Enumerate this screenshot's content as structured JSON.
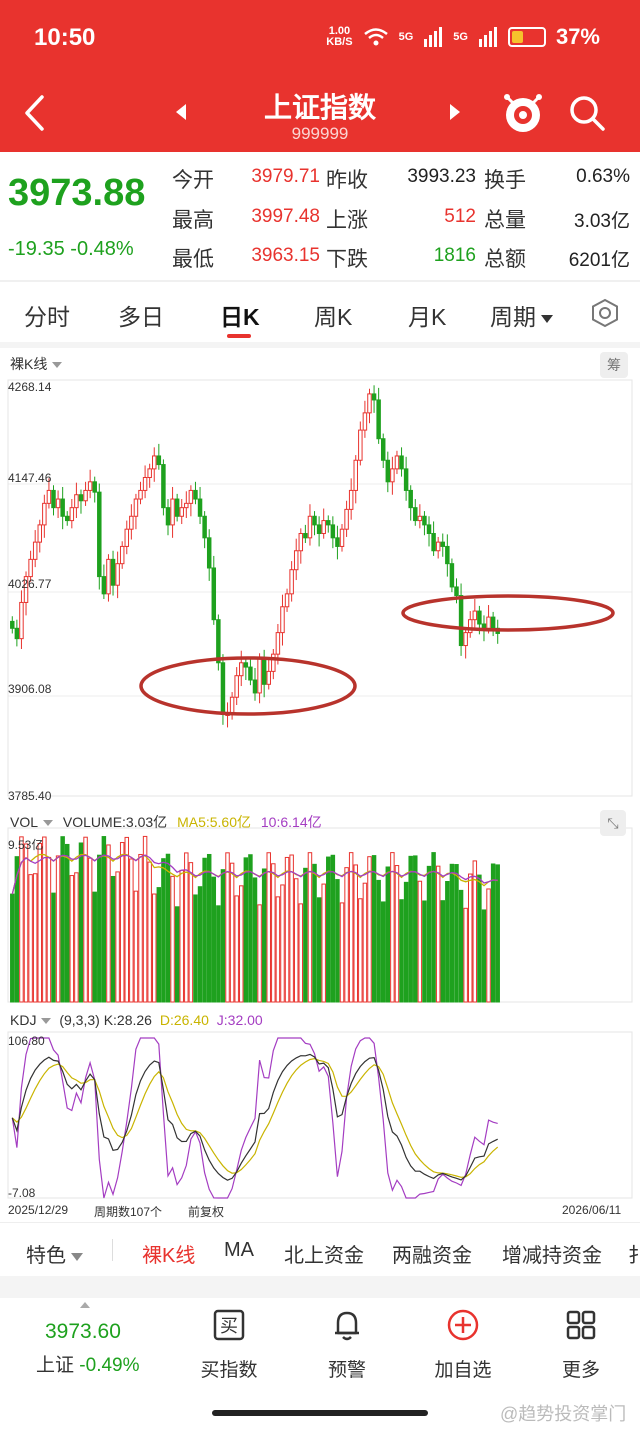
{
  "status_bar": {
    "time": "10:50",
    "speed": "1.00",
    "speed_unit": "KB/S",
    "net1": "5G",
    "net2": "5G",
    "battery": "37%",
    "battery_level": 0.37
  },
  "header": {
    "title": "上证指数",
    "code": "999999"
  },
  "quote": {
    "price": "3973.88",
    "change": "-19.35",
    "change_pct": "-0.48%",
    "open_label": "今开",
    "open": "3979.71",
    "high_label": "最高",
    "high": "3997.48",
    "low_label": "最低",
    "low": "3963.15",
    "prev_close_label": "昨收",
    "prev_close": "3993.23",
    "up_label": "上涨",
    "up": "512",
    "down_label": "下跌",
    "down": "1816",
    "turnover_label": "换手",
    "turnover": "0.63%",
    "volume_label": "总量",
    "volume": "3.03亿",
    "amount_label": "总额",
    "amount": "6201亿"
  },
  "tabs": [
    "分时",
    "多日",
    "日K",
    "周K",
    "月K",
    "周期"
  ],
  "tabs_active": "日K",
  "chart": {
    "kline_label": "裸K线",
    "chip_label": "筹",
    "y_ticks": [
      "4268.14",
      "4147.46",
      "4026.77",
      "3906.08",
      "3785.40"
    ],
    "vol_label": "VOL",
    "vol_value": "VOLUME:3.03亿",
    "vol_ma5": "MA5:5.60亿",
    "vol_ma10": "10:6.14亿",
    "vol_max": "9.53亿",
    "kdj_label": "KDJ",
    "kdj_params": "(9,3,3)",
    "kdj_k": "K:28.26",
    "kdj_d": "D:26.40",
    "kdj_j": "J:32.00",
    "kdj_max": "106.80",
    "kdj_min": "-7.08",
    "start_date": "2025/12/29",
    "period_count": "周期数107个",
    "adjust": "前复权",
    "end_date": "2026/06/11"
  },
  "chart_data": {
    "type": "candlestick",
    "ylim": [
      3785.4,
      4268.14
    ],
    "closes": [
      3980,
      3968,
      4010,
      4040,
      4060,
      4080,
      4100,
      4125,
      4140,
      4120,
      4130,
      4110,
      4105,
      4120,
      4135,
      4128,
      4140,
      4150,
      4138,
      4040,
      4020,
      4060,
      4030,
      4055,
      4075,
      4095,
      4110,
      4130,
      4140,
      4155,
      4165,
      4180,
      4170,
      4120,
      4100,
      4130,
      4110,
      4120,
      4125,
      4140,
      4130,
      4110,
      4085,
      4050,
      3990,
      3940,
      3880,
      3880,
      3900,
      3925,
      3940,
      3935,
      3920,
      3905,
      3945,
      3915,
      3930,
      3950,
      3975,
      4005,
      4020,
      4048,
      4070,
      4090,
      4085,
      4110,
      4100,
      4090,
      4105,
      4100,
      4085,
      4075,
      4095,
      4118,
      4140,
      4175,
      4210,
      4230,
      4252,
      4245,
      4200,
      4175,
      4150,
      4165,
      4180,
      4165,
      4140,
      4120,
      4105,
      4110,
      4100,
      4090,
      4070,
      4080,
      4075,
      4055,
      4028,
      4018,
      3960,
      3975,
      3990,
      4000,
      3985,
      3980,
      3993,
      3980,
      3974
    ],
    "volume_ma5": "5.60亿",
    "volume_ma10": "6.14亿",
    "volume_latest": "3.03亿",
    "kdj": {
      "K": 28.26,
      "D": 26.4,
      "J": 32.0,
      "range": [
        -7.08,
        106.8
      ]
    }
  },
  "indicators": [
    "特色",
    "裸K线",
    "MA",
    "北上资金",
    "两融资金",
    "增减持资金",
    "扌"
  ],
  "indicators_active": "裸K线",
  "bottom": {
    "price": "3973.60",
    "name": "上证",
    "pct": "-0.49%",
    "buy": "买指数",
    "buy_icon_text": "买",
    "alert": "预警",
    "add": "加自选",
    "more": "更多"
  },
  "watermark": "@趋势投资掌门",
  "colors": {
    "red": "#e8332e",
    "green": "#1ea11e",
    "ma5": "#c9b400",
    "ma10": "#a43dc2"
  }
}
